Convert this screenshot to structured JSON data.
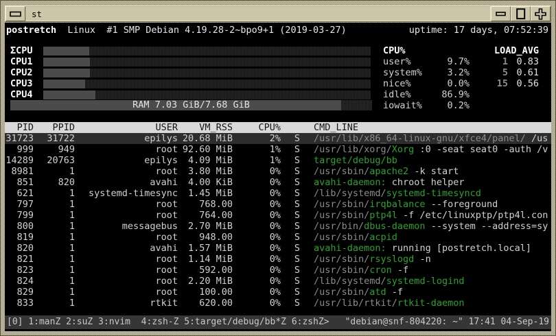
{
  "window": {
    "title": "st"
  },
  "header": {
    "host": "postretch",
    "os": "Linux  #1 SMP Debian 4.19.28-2~bpo9+1 (2019-03-27)",
    "uptime": "uptime: 17 days, 07:52:39"
  },
  "cpu_bars": {
    "labels": [
      "ΣCPU",
      "CPU1",
      "CPU2",
      "CPU3",
      "CPU4"
    ],
    "percents": [
      14.0,
      14.3,
      14.3,
      12.8,
      15.9
    ]
  },
  "ram": {
    "label": "RAM 7.03 GiB/7.68 GiB",
    "percent": 91.5
  },
  "cpu_stats": {
    "title": "CPU%",
    "rows": [
      [
        "user%",
        "9.7%"
      ],
      [
        "system%",
        "3.2%"
      ],
      [
        "nice%",
        "0.0%"
      ],
      [
        "idle%",
        "86.9%"
      ],
      [
        "iowait%",
        "0.2%"
      ]
    ]
  },
  "load_avg": {
    "title": "LOAD_AVG",
    "rows": [
      [
        "1",
        "0.83"
      ],
      [
        "5",
        "0.61"
      ],
      [
        "15",
        "0.56"
      ]
    ]
  },
  "process_table": {
    "columns": {
      "pid": "PID",
      "ppid": "PPID",
      "user": "USER",
      "rss": "VM_RSS",
      "cpu": "CPU%",
      "state": "",
      "cmd": "CMD_LINE"
    },
    "rows": [
      {
        "pid": "31723",
        "ppid": "31722",
        "user": "epilys",
        "rss": "20.68 MiB",
        "cpu": "2%",
        "state": "S",
        "selected": true,
        "cmd": [
          {
            "t": "/usr/lib/x86_64-linux-gnu/xfce4/panel/",
            "c": "dim"
          },
          {
            "t": " /us",
            "c": "fg"
          }
        ]
      },
      {
        "pid": "999",
        "ppid": "949",
        "user": "root",
        "rss": "92.60 MiB",
        "cpu": "1%",
        "state": "S",
        "selected": false,
        "cmd": [
          {
            "t": "/usr/lib/xorg/",
            "c": "dim"
          },
          {
            "t": "Xorg",
            "c": "grn"
          },
          {
            "t": " :0 -seat seat0 -auth /v",
            "c": "fg"
          }
        ]
      },
      {
        "pid": "14289",
        "ppid": "20763",
        "user": "epilys",
        "rss": "4.09 MiB",
        "cpu": "1%",
        "state": "S",
        "selected": false,
        "cmd": [
          {
            "t": "target/debug/bb",
            "c": "grn"
          }
        ]
      },
      {
        "pid": "8981",
        "ppid": "1",
        "user": "root",
        "rss": "3.80 MiB",
        "cpu": "0%",
        "state": "S",
        "selected": false,
        "cmd": [
          {
            "t": "/usr/sbin/",
            "c": "dim"
          },
          {
            "t": "apache2",
            "c": "grn"
          },
          {
            "t": " -k start",
            "c": "fg"
          }
        ]
      },
      {
        "pid": "851",
        "ppid": "820",
        "user": "avahi",
        "rss": "4.00 KiB",
        "cpu": "0%",
        "state": "S",
        "selected": false,
        "cmd": [
          {
            "t": "avahi-daemon:",
            "c": "grn"
          },
          {
            "t": " chroot helper",
            "c": "fg"
          }
        ]
      },
      {
        "pid": "621",
        "ppid": "1",
        "user": "systemd-timesync",
        "rss": "1.45 MiB",
        "cpu": "0%",
        "state": "S",
        "selected": false,
        "cmd": [
          {
            "t": "/lib/systemd/",
            "c": "dim"
          },
          {
            "t": "systemd-timesyncd",
            "c": "grn"
          }
        ]
      },
      {
        "pid": "797",
        "ppid": "1",
        "user": "root",
        "rss": "768.00 KiB",
        "cpu": "0%",
        "state": "S",
        "selected": false,
        "cmd": [
          {
            "t": "/usr/sbin/",
            "c": "dim"
          },
          {
            "t": "irqbalance",
            "c": "grn"
          },
          {
            "t": " --foreground",
            "c": "fg"
          }
        ]
      },
      {
        "pid": "799",
        "ppid": "1",
        "user": "root",
        "rss": "764.00 KiB",
        "cpu": "0%",
        "state": "S",
        "selected": false,
        "cmd": [
          {
            "t": "/usr/sbin/",
            "c": "dim"
          },
          {
            "t": "ptp4l",
            "c": "grn"
          },
          {
            "t": " -f /etc/linuxptp/ptp4l.con",
            "c": "fg"
          }
        ]
      },
      {
        "pid": "800",
        "ppid": "1",
        "user": "messagebus",
        "rss": "2.70 MiB",
        "cpu": "0%",
        "state": "S",
        "selected": false,
        "cmd": [
          {
            "t": "/usr/bin/",
            "c": "dim"
          },
          {
            "t": "dbus-daemon",
            "c": "grn"
          },
          {
            "t": " --system --address=sy",
            "c": "fg"
          }
        ]
      },
      {
        "pid": "819",
        "ppid": "1",
        "user": "root",
        "rss": "948.00 KiB",
        "cpu": "0%",
        "state": "S",
        "selected": false,
        "cmd": [
          {
            "t": "/usr/sbin/",
            "c": "dim"
          },
          {
            "t": "acpid",
            "c": "grn"
          }
        ]
      },
      {
        "pid": "820",
        "ppid": "1",
        "user": "avahi",
        "rss": "1.57 MiB",
        "cpu": "0%",
        "state": "S",
        "selected": false,
        "cmd": [
          {
            "t": "avahi-daemon:",
            "c": "grn"
          },
          {
            "t": " running [postretch.local]",
            "c": "fg"
          }
        ]
      },
      {
        "pid": "821",
        "ppid": "1",
        "user": "root",
        "rss": "1.14 MiB",
        "cpu": "0%",
        "state": "S",
        "selected": false,
        "cmd": [
          {
            "t": "/usr/sbin/",
            "c": "dim"
          },
          {
            "t": "rsyslogd",
            "c": "grn"
          },
          {
            "t": " -n",
            "c": "fg"
          }
        ]
      },
      {
        "pid": "823",
        "ppid": "1",
        "user": "root",
        "rss": "592.00 KiB",
        "cpu": "0%",
        "state": "S",
        "selected": false,
        "cmd": [
          {
            "t": "/usr/sbin/",
            "c": "dim"
          },
          {
            "t": "cron",
            "c": "grn"
          },
          {
            "t": " -f",
            "c": "fg"
          }
        ]
      },
      {
        "pid": "824",
        "ppid": "1",
        "user": "root",
        "rss": "2.20 MiB",
        "cpu": "0%",
        "state": "S",
        "selected": false,
        "cmd": [
          {
            "t": "/lib/systemd/",
            "c": "dim"
          },
          {
            "t": "systemd-logind",
            "c": "grn"
          }
        ]
      },
      {
        "pid": "829",
        "ppid": "1",
        "user": "root",
        "rss": "100.00 KiB",
        "cpu": "0%",
        "state": "S",
        "selected": false,
        "cmd": [
          {
            "t": "/usr/sbin/",
            "c": "dim"
          },
          {
            "t": "atd",
            "c": "grn"
          },
          {
            "t": " -f",
            "c": "fg"
          }
        ]
      },
      {
        "pid": "833",
        "ppid": "1",
        "user": "rtkit",
        "rss": "620.00 KiB",
        "cpu": "0%",
        "state": "S",
        "selected": false,
        "cmd": [
          {
            "t": "/usr/lib/rtkit/",
            "c": "dim"
          },
          {
            "t": "rtkit-daemon",
            "c": "grn"
          }
        ]
      }
    ]
  },
  "tmux": {
    "left": "[0] 1:manZ 2:suZ 3:nvim  4:zsh-Z 5:target/debug/bb*Z 6:zshZ>",
    "right": "\"debian@snf-804220: ~\" 17:41 04-Sep-19"
  },
  "colors": {
    "accent_green": "#28a428",
    "dim_gray": "#8d8d8d",
    "foreground": "#d2d2d2",
    "bold_white": "#ffffff",
    "terminal_bg": "#000000",
    "frame_tan": "#cdc6a8",
    "table_header_bg": "#d9d9d9",
    "selected_row_bg": "#2d2d2d",
    "tmux_bg": "#363636"
  }
}
